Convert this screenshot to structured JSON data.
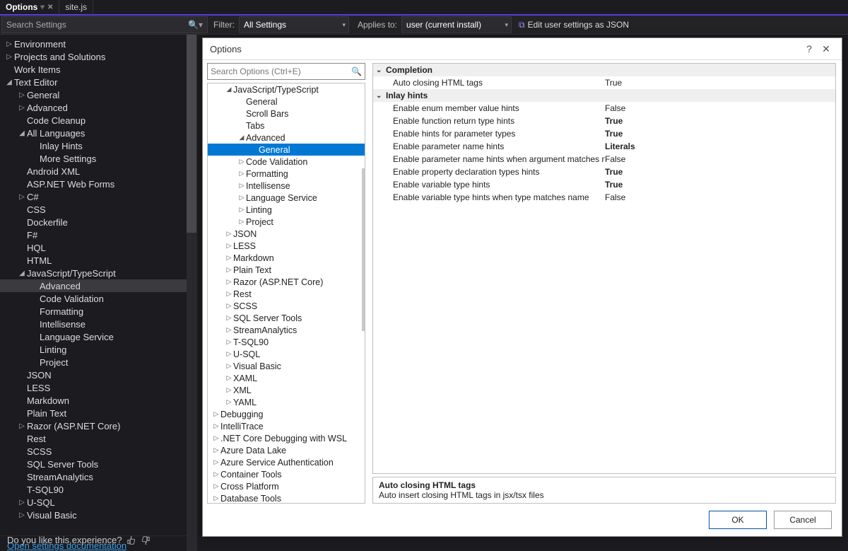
{
  "tabs": {
    "active": "Options",
    "other": "site.js"
  },
  "toolbar": {
    "search_placeholder": "Search Settings",
    "filter_label": "Filter:",
    "filter_value": "All Settings",
    "applies_label": "Applies to:",
    "applies_value": "user (current install)",
    "edit_json": "Edit user settings as JSON"
  },
  "left_tree": [
    {
      "l": "Environment",
      "d": 1,
      "a": "r"
    },
    {
      "l": "Projects and Solutions",
      "d": 1,
      "a": "r"
    },
    {
      "l": "Work Items",
      "d": 1,
      "a": ""
    },
    {
      "l": "Text Editor",
      "d": 1,
      "a": "d"
    },
    {
      "l": "General",
      "d": 2,
      "a": "r"
    },
    {
      "l": "Advanced",
      "d": 2,
      "a": "r"
    },
    {
      "l": "Code Cleanup",
      "d": 2,
      "a": ""
    },
    {
      "l": "All Languages",
      "d": 2,
      "a": "d"
    },
    {
      "l": "Inlay Hints",
      "d": 3,
      "a": ""
    },
    {
      "l": "More Settings",
      "d": 3,
      "a": ""
    },
    {
      "l": "Android XML",
      "d": 2,
      "a": ""
    },
    {
      "l": "ASP.NET Web Forms",
      "d": 2,
      "a": ""
    },
    {
      "l": "C#",
      "d": 2,
      "a": "r"
    },
    {
      "l": "CSS",
      "d": 2,
      "a": ""
    },
    {
      "l": "Dockerfile",
      "d": 2,
      "a": ""
    },
    {
      "l": "F#",
      "d": 2,
      "a": ""
    },
    {
      "l": "HQL",
      "d": 2,
      "a": ""
    },
    {
      "l": "HTML",
      "d": 2,
      "a": ""
    },
    {
      "l": "JavaScript/TypeScript",
      "d": 2,
      "a": "d"
    },
    {
      "l": "Advanced",
      "d": 3,
      "a": "",
      "sel": true
    },
    {
      "l": "Code Validation",
      "d": 3,
      "a": ""
    },
    {
      "l": "Formatting",
      "d": 3,
      "a": ""
    },
    {
      "l": "Intellisense",
      "d": 3,
      "a": ""
    },
    {
      "l": "Language Service",
      "d": 3,
      "a": ""
    },
    {
      "l": "Linting",
      "d": 3,
      "a": ""
    },
    {
      "l": "Project",
      "d": 3,
      "a": ""
    },
    {
      "l": "JSON",
      "d": 2,
      "a": ""
    },
    {
      "l": "LESS",
      "d": 2,
      "a": ""
    },
    {
      "l": "Markdown",
      "d": 2,
      "a": ""
    },
    {
      "l": "Plain Text",
      "d": 2,
      "a": ""
    },
    {
      "l": "Razor (ASP.NET Core)",
      "d": 2,
      "a": "r"
    },
    {
      "l": "Rest",
      "d": 2,
      "a": ""
    },
    {
      "l": "SCSS",
      "d": 2,
      "a": ""
    },
    {
      "l": "SQL Server Tools",
      "d": 2,
      "a": ""
    },
    {
      "l": "StreamAnalytics",
      "d": 2,
      "a": ""
    },
    {
      "l": "T-SQL90",
      "d": 2,
      "a": ""
    },
    {
      "l": "U-SQL",
      "d": 2,
      "a": "r"
    },
    {
      "l": "Visual Basic",
      "d": 2,
      "a": "r"
    }
  ],
  "footer_link": "Open settings documentation",
  "feedback": "Do you like this experience?",
  "dialog": {
    "title": "Options",
    "search_placeholder": "Search Options (Ctrl+E)",
    "tree": [
      {
        "l": "JavaScript/TypeScript",
        "d": 1,
        "a": "d"
      },
      {
        "l": "General",
        "d": 2,
        "a": ""
      },
      {
        "l": "Scroll Bars",
        "d": 2,
        "a": ""
      },
      {
        "l": "Tabs",
        "d": 2,
        "a": ""
      },
      {
        "l": "Advanced",
        "d": 2,
        "a": "d"
      },
      {
        "l": "General",
        "d": 3,
        "a": "",
        "sel": true
      },
      {
        "l": "Code Validation",
        "d": 2,
        "a": "r"
      },
      {
        "l": "Formatting",
        "d": 2,
        "a": "r"
      },
      {
        "l": "Intellisense",
        "d": 2,
        "a": "r"
      },
      {
        "l": "Language Service",
        "d": 2,
        "a": "r"
      },
      {
        "l": "Linting",
        "d": 2,
        "a": "r"
      },
      {
        "l": "Project",
        "d": 2,
        "a": "r"
      },
      {
        "l": "JSON",
        "d": 1,
        "a": "r"
      },
      {
        "l": "LESS",
        "d": 1,
        "a": "r"
      },
      {
        "l": "Markdown",
        "d": 1,
        "a": "r"
      },
      {
        "l": "Plain Text",
        "d": 1,
        "a": "r"
      },
      {
        "l": "Razor (ASP.NET Core)",
        "d": 1,
        "a": "r"
      },
      {
        "l": "Rest",
        "d": 1,
        "a": "r"
      },
      {
        "l": "SCSS",
        "d": 1,
        "a": "r"
      },
      {
        "l": "SQL Server Tools",
        "d": 1,
        "a": "r"
      },
      {
        "l": "StreamAnalytics",
        "d": 1,
        "a": "r"
      },
      {
        "l": "T-SQL90",
        "d": 1,
        "a": "r"
      },
      {
        "l": "U-SQL",
        "d": 1,
        "a": "r"
      },
      {
        "l": "Visual Basic",
        "d": 1,
        "a": "r"
      },
      {
        "l": "XAML",
        "d": 1,
        "a": "r"
      },
      {
        "l": "XML",
        "d": 1,
        "a": "r"
      },
      {
        "l": "YAML",
        "d": 1,
        "a": "r"
      },
      {
        "l": "Debugging",
        "d": 0,
        "a": "r"
      },
      {
        "l": "IntelliTrace",
        "d": 0,
        "a": "r"
      },
      {
        "l": ".NET Core Debugging with WSL",
        "d": 0,
        "a": "r"
      },
      {
        "l": "Azure Data Lake",
        "d": 0,
        "a": "r"
      },
      {
        "l": "Azure Service Authentication",
        "d": 0,
        "a": "r"
      },
      {
        "l": "Container Tools",
        "d": 0,
        "a": "r"
      },
      {
        "l": "Cross Platform",
        "d": 0,
        "a": "r"
      },
      {
        "l": "Database Tools",
        "d": 0,
        "a": "r"
      }
    ],
    "groups": [
      {
        "name": "Completion",
        "rows": [
          {
            "n": "Auto closing HTML tags",
            "v": "True"
          }
        ]
      },
      {
        "name": "Inlay hints",
        "rows": [
          {
            "n": "Enable enum member value hints",
            "v": "False"
          },
          {
            "n": "Enable function return type hints",
            "v": "True",
            "b": true
          },
          {
            "n": "Enable hints for parameter types",
            "v": "True",
            "b": true
          },
          {
            "n": "Enable parameter name hints",
            "v": "Literals",
            "b": true
          },
          {
            "n": "Enable parameter name hints when argument matches nam",
            "v": "False"
          },
          {
            "n": "Enable property declaration types hints",
            "v": "True",
            "b": true
          },
          {
            "n": "Enable variable type hints",
            "v": "True",
            "b": true
          },
          {
            "n": "Enable variable type hints when type matches name",
            "v": "False"
          }
        ]
      }
    ],
    "desc": {
      "t": "Auto closing HTML tags",
      "d": "Auto insert closing HTML tags in jsx/tsx files"
    },
    "ok": "OK",
    "cancel": "Cancel"
  }
}
